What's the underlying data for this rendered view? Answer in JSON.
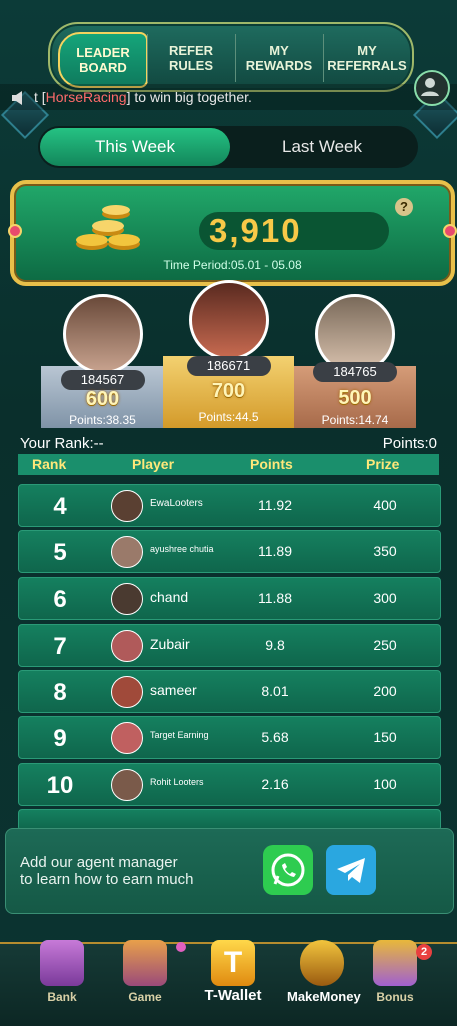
{
  "tabs": [
    {
      "label": "LEADER BOARD"
    },
    {
      "label": "REFER RULES"
    },
    {
      "label": "MY REWARDS"
    },
    {
      "label": "MY REFERRALS"
    }
  ],
  "notice": {
    "prefix": "t [",
    "game": "HorseRacing",
    "suffix": "] to win big together."
  },
  "week": {
    "this_week": "This Week",
    "last_week": "Last Week"
  },
  "banner": {
    "amount": "3,910",
    "period": "Time Period:05.01 - 05.08",
    "help": "?"
  },
  "podium": [
    {
      "place": 2,
      "uid": "184567",
      "prize": "600",
      "points": "Points:38.35"
    },
    {
      "place": 1,
      "uid": "186671",
      "prize": "700",
      "points": "Points:44.5"
    },
    {
      "place": 3,
      "uid": "184765",
      "prize": "500",
      "points": "Points:14.74"
    }
  ],
  "your_rank": "Your Rank:--",
  "your_points": "Points:0",
  "table": {
    "headers": {
      "rank": "Rank",
      "player": "Player",
      "points": "Points",
      "prize": "Prize"
    },
    "rows": [
      {
        "rank": "4",
        "name": "EwaLooters",
        "points": "11.92",
        "prize": "400"
      },
      {
        "rank": "5",
        "name": "ayushree chutia",
        "points": "11.89",
        "prize": "350"
      },
      {
        "rank": "6",
        "name": "chand",
        "points": "11.88",
        "prize": "300"
      },
      {
        "rank": "7",
        "name": "Zubair",
        "points": "9.8",
        "prize": "250"
      },
      {
        "rank": "8",
        "name": "sameer",
        "points": "8.01",
        "prize": "200"
      },
      {
        "rank": "9",
        "name": "Target Earning",
        "points": "5.68",
        "prize": "150"
      },
      {
        "rank": "10",
        "name": "Rohit Looters",
        "points": "2.16",
        "prize": "100"
      }
    ]
  },
  "agent": {
    "line1": "Add our agent manager",
    "line2": "to learn how to earn much"
  },
  "nav": [
    {
      "label": "Bank"
    },
    {
      "label": "Game"
    },
    {
      "label": "T-Wallet"
    },
    {
      "label": "MakeMoney"
    },
    {
      "label": "Bonus",
      "badge": "2"
    }
  ],
  "colors": {
    "accent": "#1a8f6c",
    "gold": "#f7c948",
    "header_text": "#ffe87a"
  }
}
